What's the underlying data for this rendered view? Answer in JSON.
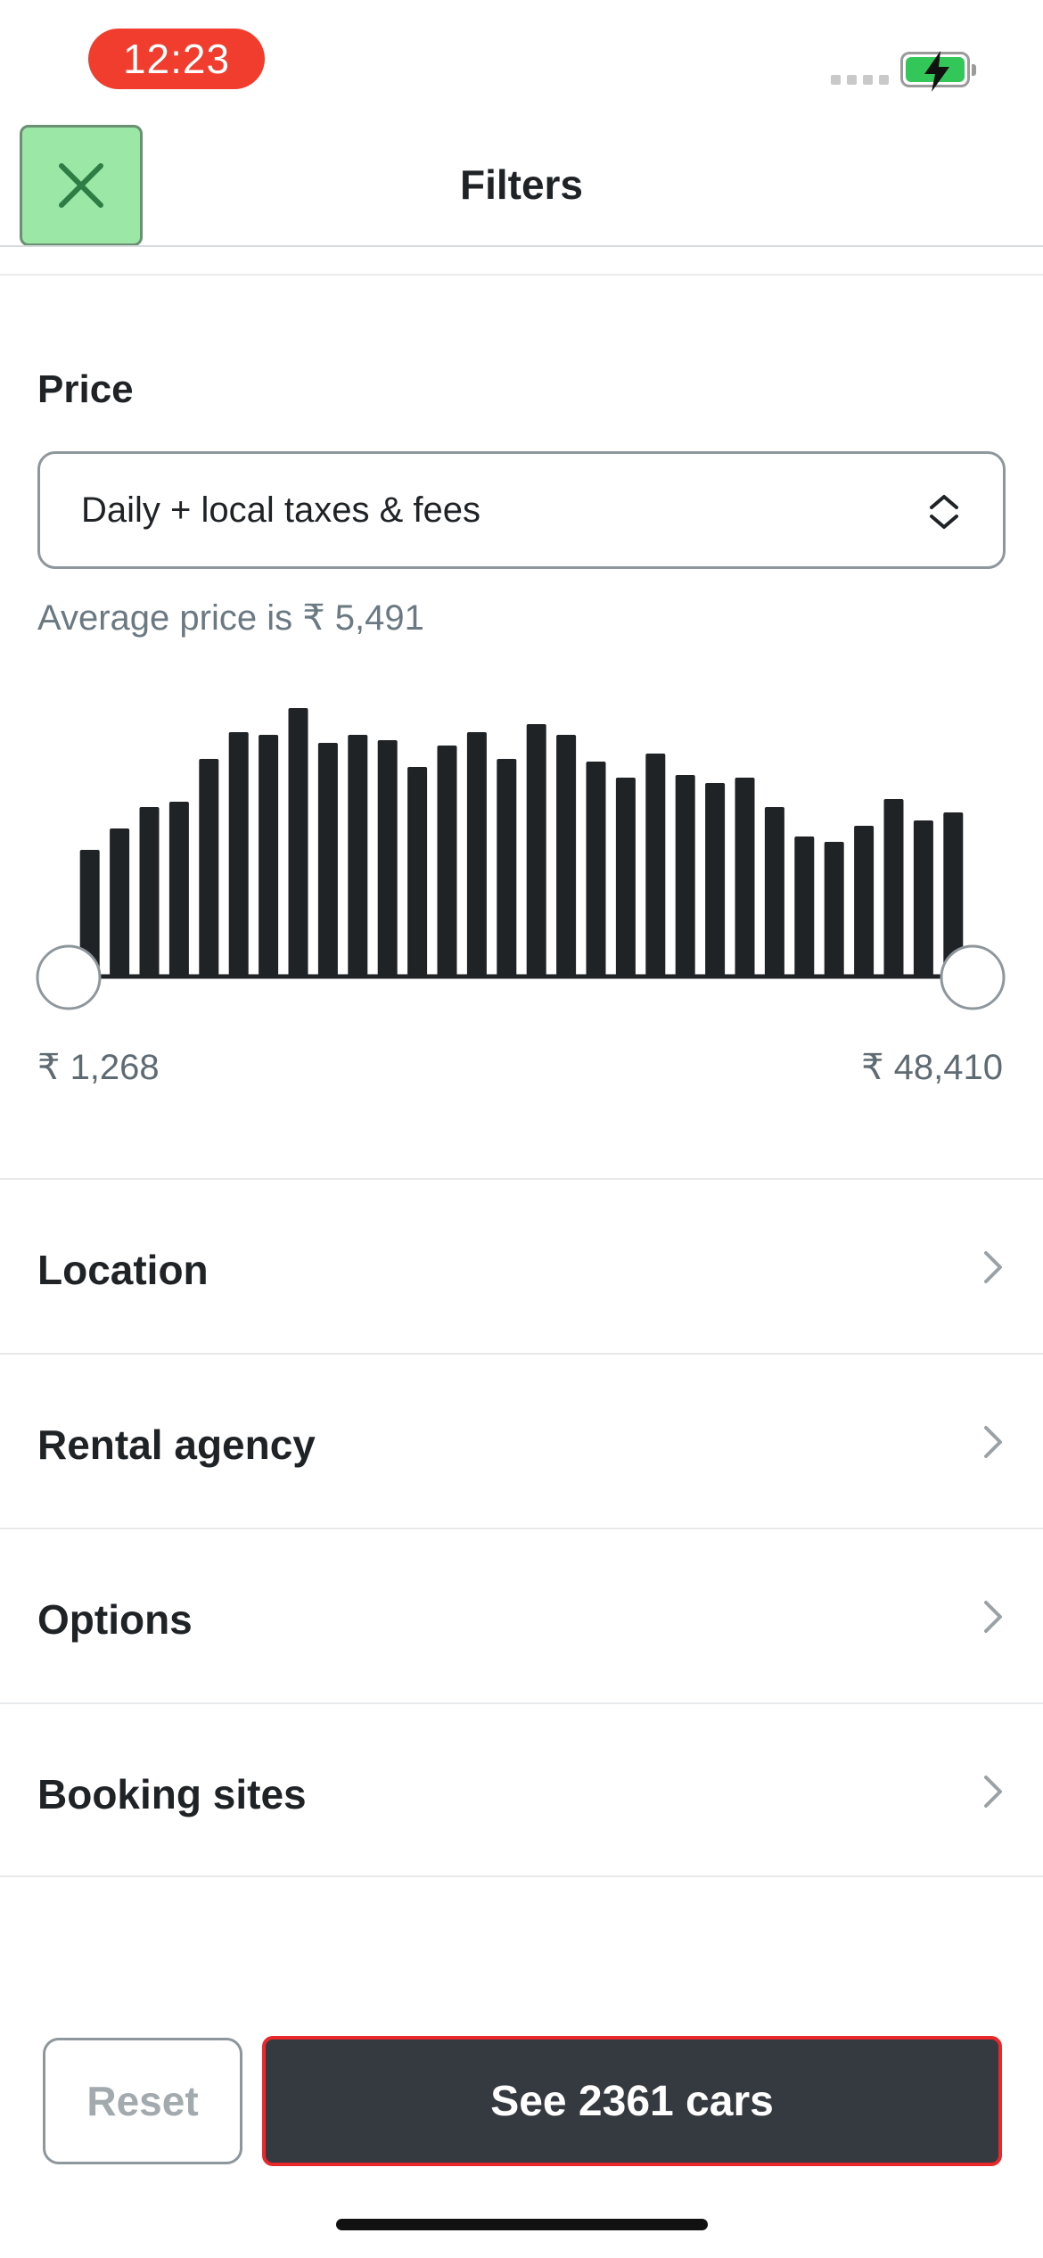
{
  "status_bar": {
    "time": "12:23"
  },
  "header": {
    "title": "Filters",
    "close_icon": "close-icon"
  },
  "price": {
    "section_title": "Price",
    "select_value": "Daily + local taxes & fees",
    "average_text": "Average price is ₹ 5,491",
    "range_min": "₹ 1,268",
    "range_max": "₹ 48,410",
    "histogram_levels": [
      0.47,
      0.55,
      0.63,
      0.65,
      0.81,
      0.91,
      0.9,
      1.0,
      0.87,
      0.9,
      0.88,
      0.78,
      0.86,
      0.91,
      0.81,
      0.94,
      0.9,
      0.8,
      0.74,
      0.83,
      0.75,
      0.72,
      0.74,
      0.63,
      0.52,
      0.5,
      0.56,
      0.66,
      0.58,
      0.61
    ],
    "bar_color": "#1f2326"
  },
  "sections": [
    {
      "label": "Location"
    },
    {
      "label": "Rental agency"
    },
    {
      "label": "Options"
    },
    {
      "label": "Booking sites"
    }
  ],
  "actions": {
    "reset_label": "Reset",
    "submit_label": "See 2361 cars"
  }
}
